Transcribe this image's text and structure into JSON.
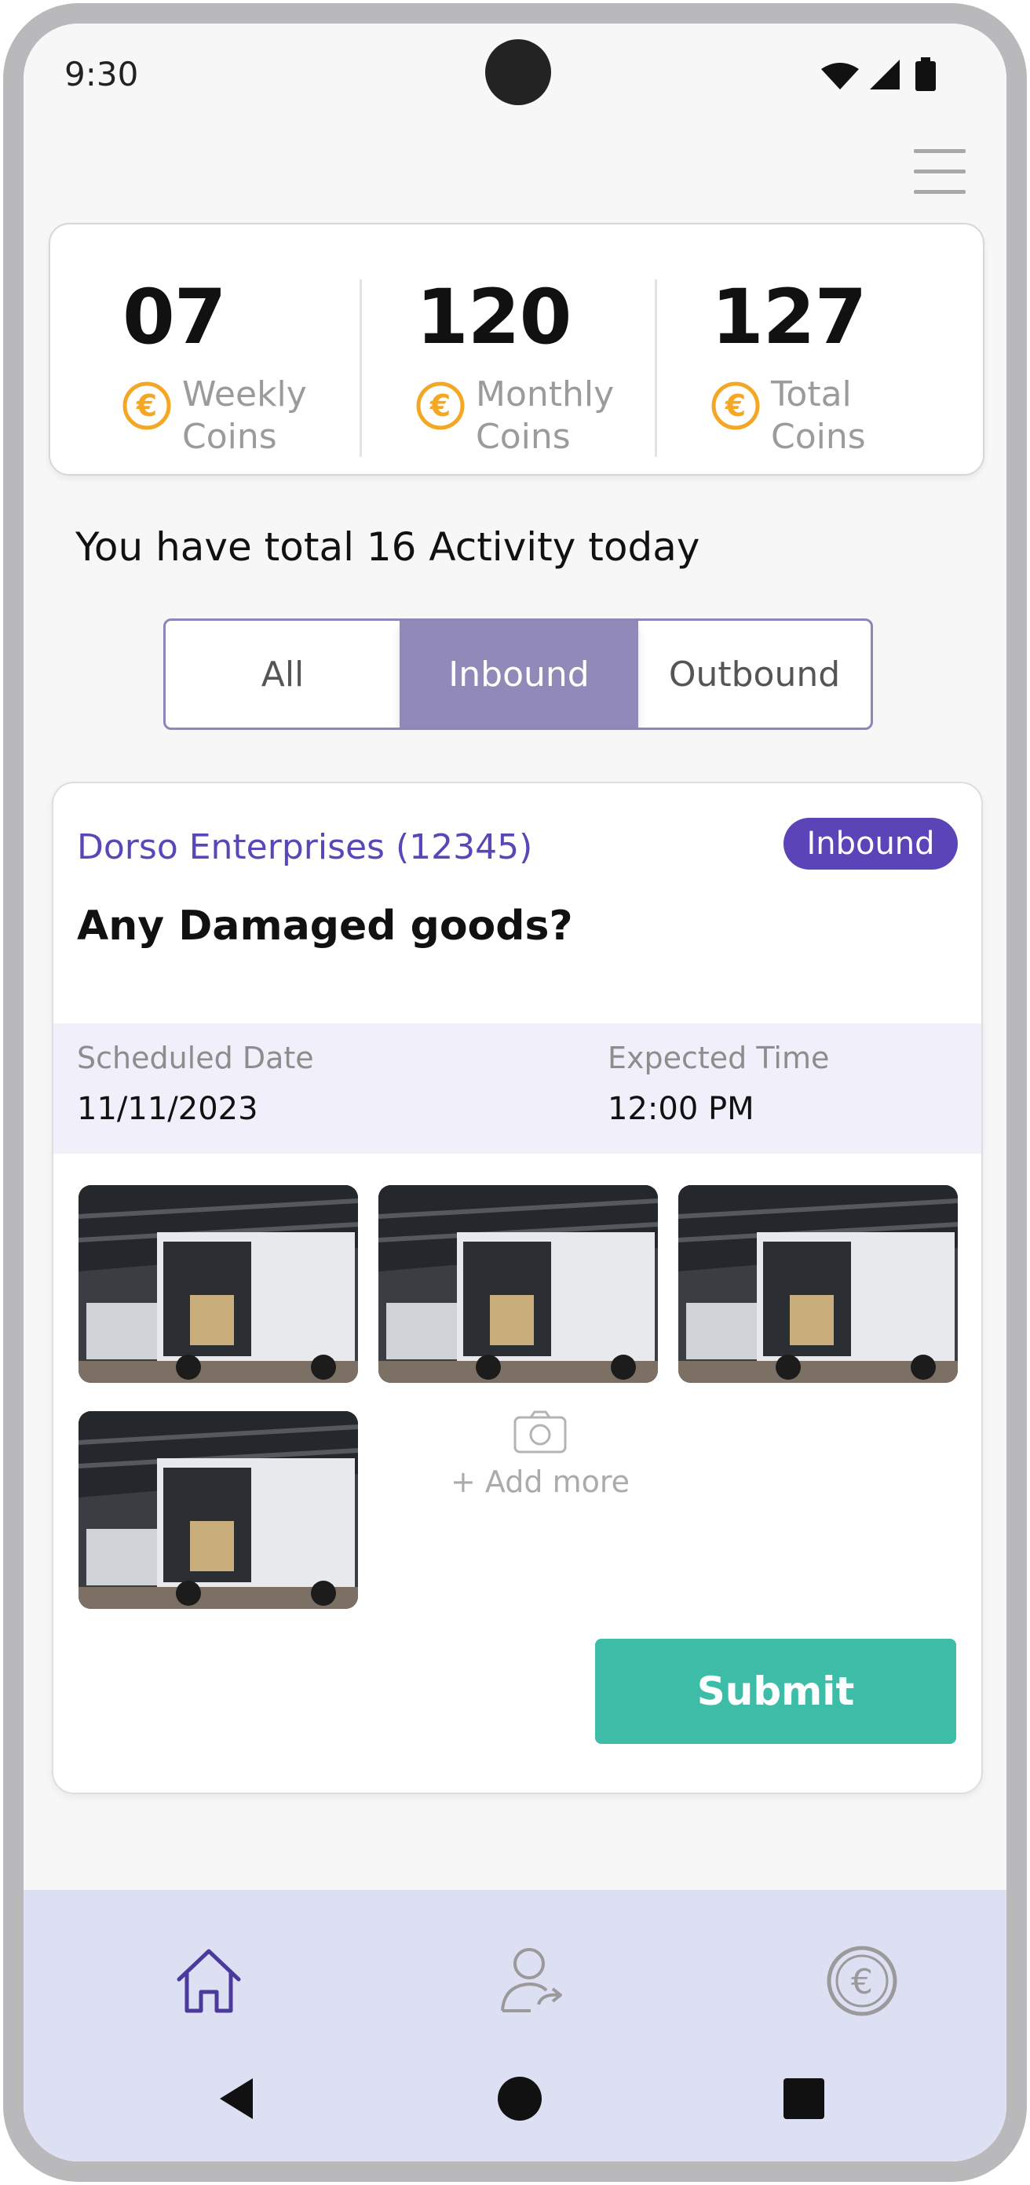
{
  "status_bar": {
    "time": "9:30"
  },
  "coins": [
    {
      "value": "07",
      "label_line1": "Weekly",
      "label_line2": "Coins"
    },
    {
      "value": "120",
      "label_line1": "Monthly",
      "label_line2": "Coins"
    },
    {
      "value": "127",
      "label_line1": "Total",
      "label_line2": "Coins"
    }
  ],
  "activity_summary": "You have total 16 Activity today",
  "tabs": [
    {
      "label": "All",
      "active": false
    },
    {
      "label": "Inbound",
      "active": true
    },
    {
      "label": "Outbound",
      "active": false
    }
  ],
  "activity_card": {
    "company": "Dorso Enterprises (12345)",
    "badge": "Inbound",
    "question": "Any Damaged goods?",
    "scheduled_date_label": "Scheduled Date",
    "scheduled_date": "11/11/2023",
    "expected_time_label": "Expected Time",
    "expected_time": "12:00 PM",
    "add_more_label": "+ Add more",
    "submit_label": "Submit"
  },
  "colors": {
    "accent_purple": "#5b44b8",
    "tab_active": "#9189b8",
    "submit_green": "#3dbda8",
    "coin_orange": "#f3a724",
    "nav_bg": "#dddff3"
  },
  "icons": [
    "wifi-icon",
    "signal-icon",
    "battery-icon",
    "menu-icon",
    "euro-coin-icon",
    "camera-icon",
    "home-icon",
    "user-transfer-icon",
    "euro-circle-icon",
    "back-icon",
    "home-circle-icon",
    "recents-icon"
  ]
}
